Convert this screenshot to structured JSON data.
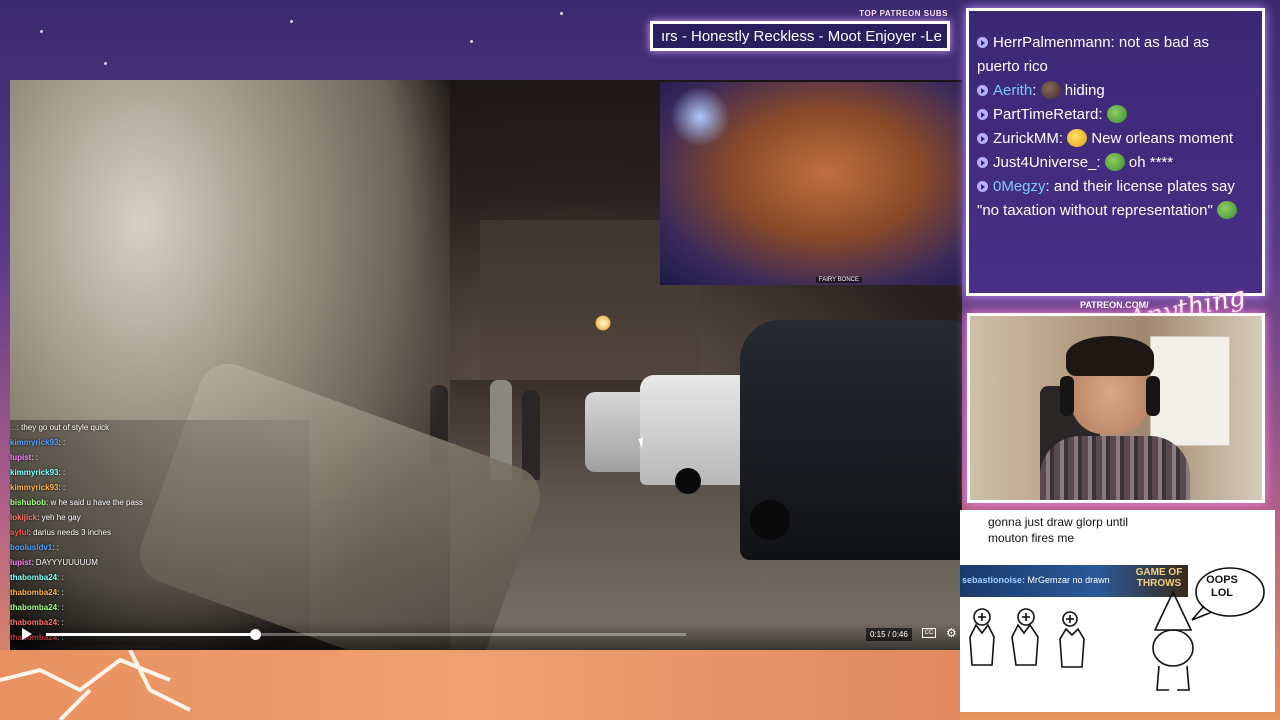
{
  "top_subs": {
    "label": "TOP PATREON SUBS",
    "ticker": "ırs - Honestly Reckless - Moot Enjoyer -Le"
  },
  "stream_chat": {
    "messages": [
      {
        "name": "HerrPalmenmann",
        "name_color": "#ffffff",
        "text": "not as bad as puerto rico",
        "emote": null
      },
      {
        "name": "Aerith",
        "name_color": "#7ec8ff",
        "text": "hiding",
        "emote": "emote-hat"
      },
      {
        "name": "PartTimeRetard",
        "name_color": "#ffffff",
        "text": "",
        "emote": "emote-pepe"
      },
      {
        "name": "ZurickMM",
        "name_color": "#ffffff",
        "text": "New orleans moment",
        "emote": "emote-bird"
      },
      {
        "name": "Just4Universe_",
        "name_color": "#ffffff",
        "text": "oh ****",
        "emote": "emote-pepe"
      },
      {
        "name": "0Megzy",
        "name_color": "#7ec8ff",
        "text": "and their license plates say \"no taxation without representation\"",
        "emote": "emote-pepe"
      }
    ]
  },
  "patreon_url": "PATREON.COM/",
  "logo_text": "Anything Else",
  "video": {
    "time": "0:15 / 0:46",
    "progress": 0.326,
    "cc_label": "CC",
    "pip_label": "FAIRY BONCE",
    "chat": [
      {
        "name": "...",
        "text": "they go out of style quick"
      },
      {
        "name": "kimmyrick93",
        "text": ":"
      },
      {
        "name": "lupist",
        "text": ":"
      },
      {
        "name": "kimmyrick93",
        "text": ":"
      },
      {
        "name": "kimmyrick93",
        "text": ":"
      },
      {
        "name": "bishubob",
        "text": "w he said u have the pass"
      },
      {
        "name": "lokijick",
        "text": "yeh he gay"
      },
      {
        "name": "ayful",
        "text": "darius needs 3 inches"
      },
      {
        "name": "boolusldv1",
        "text": ":"
      },
      {
        "name": "lupist",
        "text": "DAYYYUUUUUM"
      },
      {
        "name": "thabomba24",
        "text": ":"
      },
      {
        "name": "thabomba24",
        "text": ":"
      },
      {
        "name": "thabomba24",
        "text": ":"
      },
      {
        "name": "thabomba24",
        "text": ":"
      },
      {
        "name": "thabomba24",
        "text": ":"
      }
    ]
  },
  "board": {
    "note": "gonna just draw glorp until mouton fires me",
    "banner_name": "sebastionoise:",
    "banner_text": "MrGemzar no",
    "banner_text2": "drawn",
    "brand": "GAME OF THROWS",
    "oops": "OOPS LOL"
  }
}
